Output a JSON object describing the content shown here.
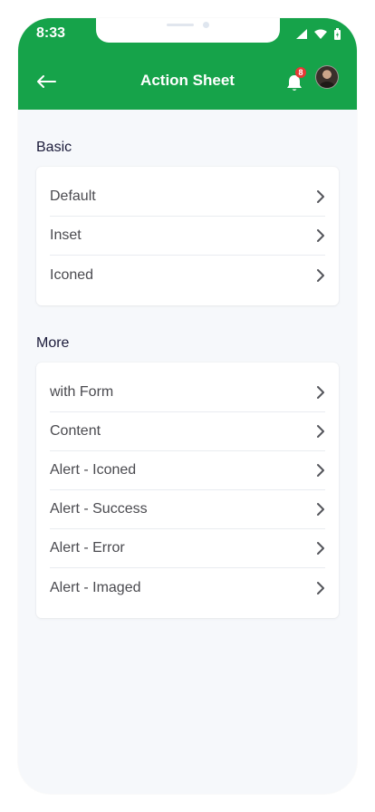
{
  "status_bar": {
    "time": "8:33"
  },
  "header": {
    "title": "Action Sheet",
    "notification_count": "8"
  },
  "sections": [
    {
      "title": "Basic",
      "items": [
        {
          "label": "Default"
        },
        {
          "label": "Inset"
        },
        {
          "label": "Iconed"
        }
      ]
    },
    {
      "title": "More",
      "items": [
        {
          "label": "with Form"
        },
        {
          "label": "Content"
        },
        {
          "label": "Alert - Iconed"
        },
        {
          "label": "Alert - Success"
        },
        {
          "label": "Alert - Error"
        },
        {
          "label": "Alert - Imaged"
        }
      ]
    }
  ],
  "icons": {
    "back": "arrow-left-icon",
    "chevron": "chevron-right-icon",
    "bell": "bell-icon"
  },
  "colors": {
    "header_green": "#16a34a",
    "badge_red": "#e53935",
    "page_bg": "#f6f8fb"
  }
}
